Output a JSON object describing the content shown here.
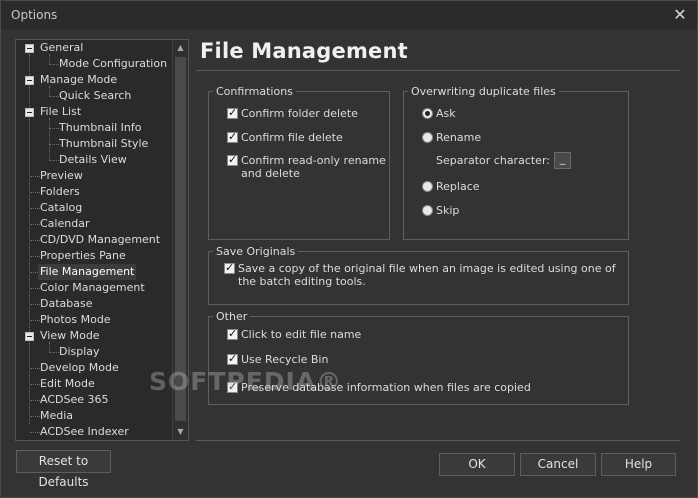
{
  "window": {
    "title": "Options",
    "close_glyph": "✕"
  },
  "tree": {
    "items": [
      {
        "label": "General"
      },
      {
        "label": "Mode Configuration"
      },
      {
        "label": "Manage Mode"
      },
      {
        "label": "Quick Search"
      },
      {
        "label": "File List"
      },
      {
        "label": "Thumbnail Info"
      },
      {
        "label": "Thumbnail Style"
      },
      {
        "label": "Details View"
      },
      {
        "label": "Preview"
      },
      {
        "label": "Folders"
      },
      {
        "label": "Catalog"
      },
      {
        "label": "Calendar"
      },
      {
        "label": "CD/DVD Management"
      },
      {
        "label": "Properties Pane"
      },
      {
        "label": "File Management",
        "selected": true
      },
      {
        "label": "Color Management"
      },
      {
        "label": "Database"
      },
      {
        "label": "Photos Mode"
      },
      {
        "label": "View Mode"
      },
      {
        "label": "Display"
      },
      {
        "label": "Develop Mode"
      },
      {
        "label": "Edit Mode"
      },
      {
        "label": "ACDSee 365"
      },
      {
        "label": "Media"
      },
      {
        "label": "ACDSee Indexer"
      }
    ],
    "scroll_up_glyph": "▲",
    "scroll_down_glyph": "▼"
  },
  "page": {
    "title": "File Management"
  },
  "confirmations": {
    "legend": "Confirmations",
    "folder_delete": "Confirm folder delete",
    "file_delete": "Confirm file delete",
    "readonly": "Confirm read-only rename and delete"
  },
  "overwriting": {
    "legend": "Overwriting duplicate files",
    "ask": "Ask",
    "rename": "Rename",
    "separator_label": "Separator character:",
    "separator_value": "_",
    "replace": "Replace",
    "skip": "Skip",
    "selected": "ask"
  },
  "save_originals": {
    "legend": "Save Originals",
    "save_copy": "Save a copy of the original file when an image is edited using one of the batch editing tools."
  },
  "other": {
    "legend": "Other",
    "click_edit": "Click to edit file name",
    "recycle": "Use Recycle Bin",
    "preserve": "Preserve database information when files are copied"
  },
  "buttons": {
    "reset": "Reset to Defaults",
    "ok": "OK",
    "cancel": "Cancel",
    "help": "Help"
  },
  "watermark": "SOFTPEDIA®"
}
